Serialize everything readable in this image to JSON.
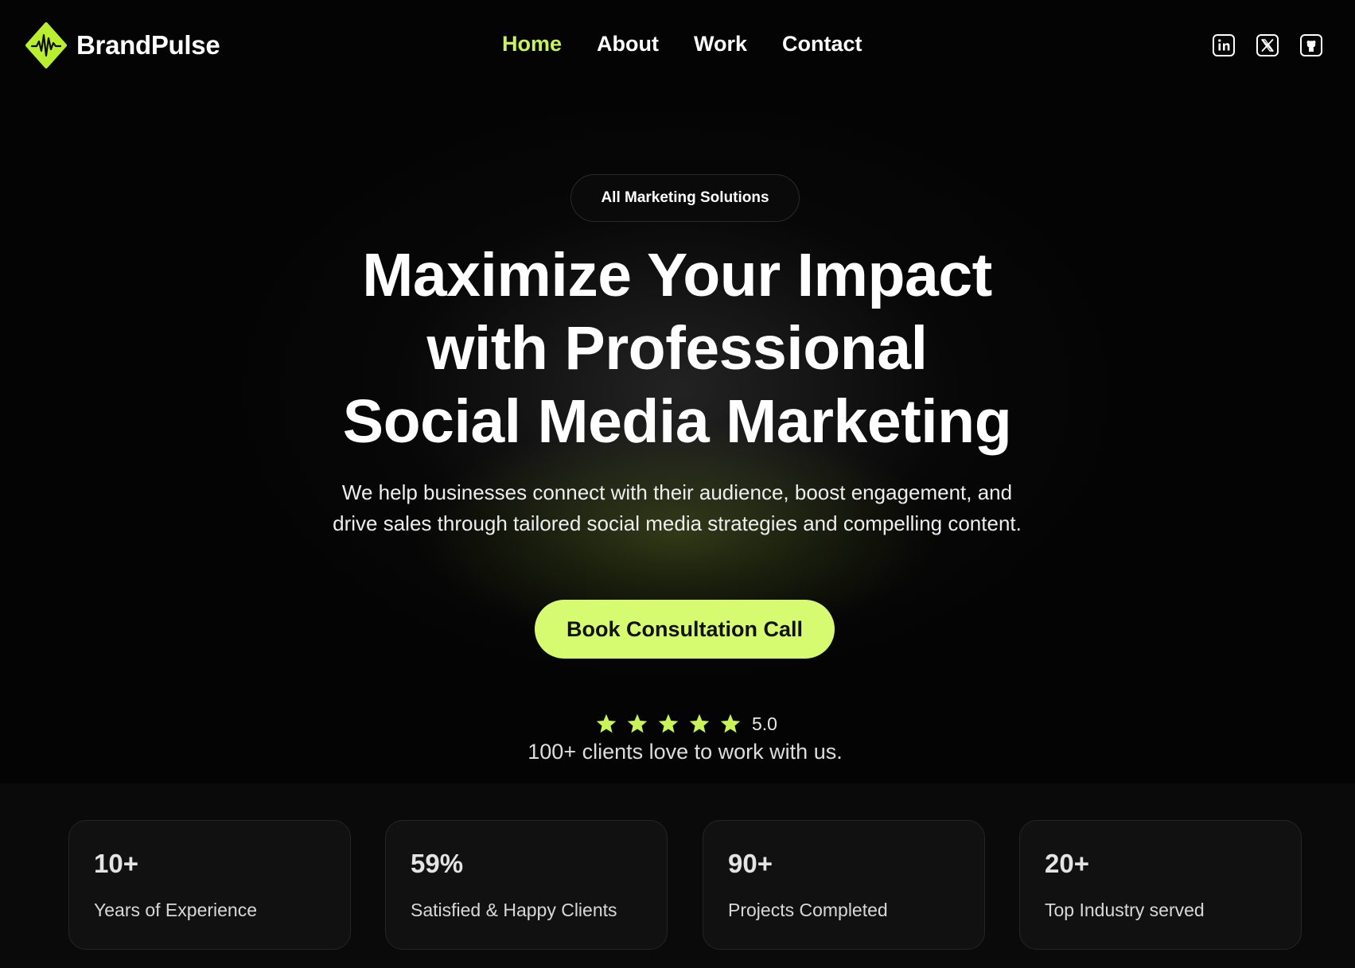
{
  "brand": {
    "name": "BrandPulse",
    "accent": "#c8f45a"
  },
  "nav": {
    "items": [
      {
        "label": "Home",
        "active": true
      },
      {
        "label": "About",
        "active": false
      },
      {
        "label": "Work",
        "active": false
      },
      {
        "label": "Contact",
        "active": false
      }
    ],
    "socials": [
      "linkedin-icon",
      "x-icon",
      "github-icon"
    ]
  },
  "hero": {
    "badge": "All Marketing Solutions",
    "headline_lines": [
      "Maximize Your Impact",
      "with Professional",
      "Social Media Marketing"
    ],
    "subtext_lines": [
      "We help businesses connect with their audience, boost engagement, and",
      "drive sales through tailored social media strategies and compelling content."
    ],
    "cta_label": "Book Consultation Call",
    "cta_color": "#d7fb70",
    "rating": {
      "stars": 5,
      "value": "5.0"
    },
    "clients_text": "100+ clients love to work with us."
  },
  "stats": [
    {
      "value": "10+",
      "label": "Years of Experience"
    },
    {
      "value": "59%",
      "label": "Satisfied & Happy Clients"
    },
    {
      "value": "90+",
      "label": "Projects Completed"
    },
    {
      "value": "20+",
      "label": "Top Industry served"
    }
  ]
}
